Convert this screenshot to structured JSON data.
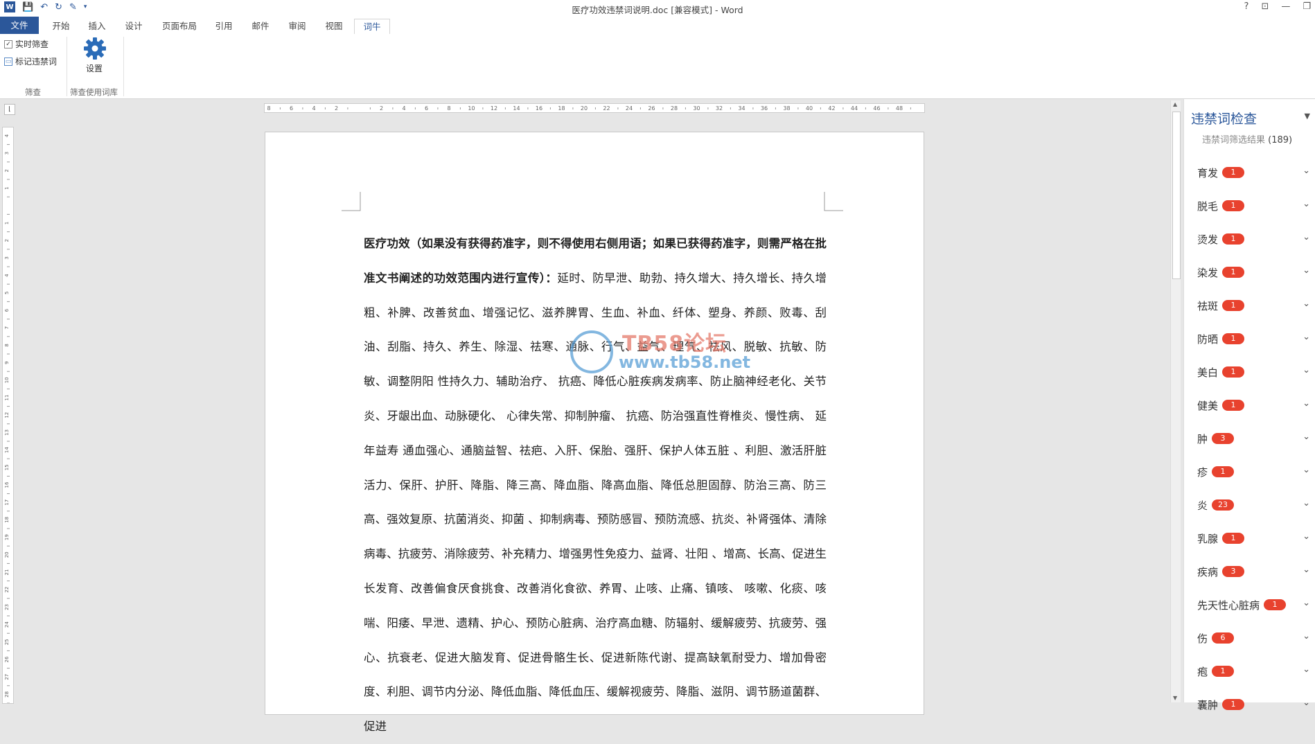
{
  "window": {
    "title": "医疗功效违禁词说明.doc [兼容模式] - Word",
    "controls": [
      "?",
      "⊡",
      "—",
      "❐"
    ]
  },
  "tabs": [
    "文件",
    "开始",
    "插入",
    "设计",
    "页面布局",
    "引用",
    "邮件",
    "审阅",
    "视图",
    "词牛"
  ],
  "ribbon": {
    "realtime_filter": "实时筛查",
    "mark_words": "标记违禁词",
    "group_filter": "筛查",
    "settings": "设置",
    "group_dict": "筛查使用词库"
  },
  "ruler": {
    "h_ticks": [
      "8",
      "6",
      "4",
      "2",
      "",
      "2",
      "4",
      "6",
      "8",
      "10",
      "12",
      "14",
      "16",
      "18",
      "20",
      "22",
      "24",
      "26",
      "28",
      "30",
      "32",
      "34",
      "36",
      "38",
      "40",
      "42",
      "44",
      "46",
      "48"
    ],
    "v_ticks": [
      "4",
      "3",
      "2",
      "1",
      "",
      "1",
      "2",
      "3",
      "4",
      "5",
      "6",
      "7",
      "8",
      "9",
      "10",
      "11",
      "12",
      "13",
      "14",
      "15",
      "16",
      "17",
      "18",
      "19",
      "20",
      "21",
      "22",
      "23",
      "24",
      "25",
      "26",
      "27",
      "28"
    ]
  },
  "document": {
    "heading": "医疗功效（如果没有获得药准字，则不得使用右侧用语；如果已获得药准字，则需严格在批准文书阐述的功效范围内进行宣传）：",
    "body": "延时、防早泄、助勃、持久增大、持久增长、持久增粗、补脾、改善贫血、增强记忆、滋养脾胃、生血、补血、纤体、塑身、养颜、败毒、刮油、刮脂、持久、养生、除湿、祛寒、通脉、行气、益气、理气、祛风、脱敏、抗敏、防敏、调整阴阳 性持久力、辅助治疗、 抗癌、降低心脏疾病发病率、防止脑神经老化、关节炎、牙龈出血、动脉硬化、 心律失常、抑制肿瘤、 抗癌、防治强直性脊椎炎、慢性病、 延年益寿 通血强心、通脑益智、祛疤、入肝、保胎、强肝、保护人体五脏 、利胆、激活肝脏活力、保肝、护肝、降脂、降三高、降血脂、降高血脂、降低总胆固醇、防治三高、防三高、强效复原、抗菌消炎、抑菌 、抑制病毒、预防感冒、预防流感、抗炎、补肾强体、清除病毒、抗疲劳、消除疲劳、补充精力、增强男性免疫力、益肾、壮阳 、增高、长高、促进生长发育、改善偏食厌食挑食、改善消化食欲、养胃、止咳、止痛、镇咳、 咳嗽、化痰、咳喘、阳痿、早泄、遗精、护心、预防心脏病、治疗高血糖、防辐射、缓解疲劳、抗疲劳、强心、抗衰老、促进大脑发育、促进骨骼生长、促进新陈代谢、提高缺氧耐受力、增加骨密度、利胆、调节内分泌、降低血脂、降低血压、缓解视疲劳、降脂、滋阴、调节肠道菌群、促进"
  },
  "watermark": {
    "line1": "TB58论坛",
    "line2": "www.tb58.net"
  },
  "panel": {
    "title": "违禁词检查",
    "subtitle": "违禁词筛选结果",
    "total": "(189)",
    "items": [
      {
        "word": "育发",
        "count": "1"
      },
      {
        "word": "脱毛",
        "count": "1"
      },
      {
        "word": "烫发",
        "count": "1"
      },
      {
        "word": "染发",
        "count": "1"
      },
      {
        "word": "祛斑",
        "count": "1"
      },
      {
        "word": "防晒",
        "count": "1"
      },
      {
        "word": "美白",
        "count": "1"
      },
      {
        "word": "健美",
        "count": "1"
      },
      {
        "word": "肿",
        "count": "3"
      },
      {
        "word": "疹",
        "count": "1"
      },
      {
        "word": "炎",
        "count": "23"
      },
      {
        "word": "乳腺",
        "count": "1"
      },
      {
        "word": "疾病",
        "count": "3"
      },
      {
        "word": "先天性心脏病",
        "count": "1"
      },
      {
        "word": "伤",
        "count": "6"
      },
      {
        "word": "疱",
        "count": "1"
      },
      {
        "word": "囊肿",
        "count": "1"
      }
    ]
  },
  "colors": {
    "accent": "#2b579a",
    "badge": "#e8422e"
  }
}
